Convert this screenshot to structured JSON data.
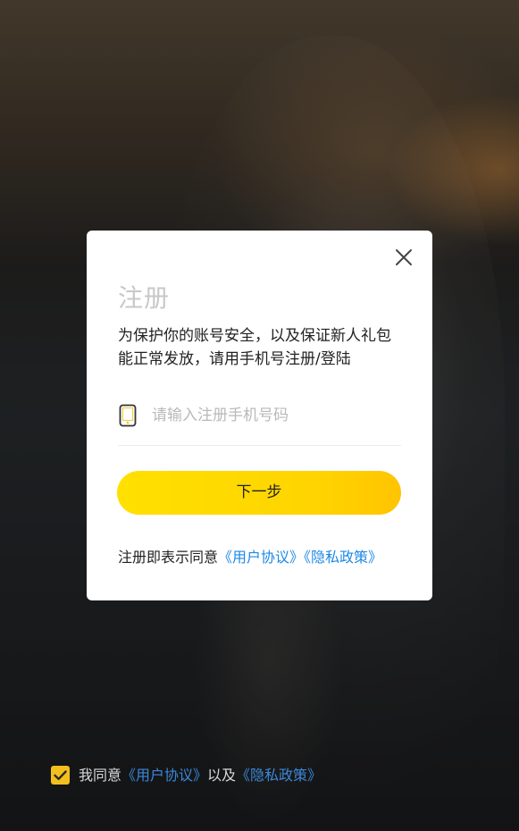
{
  "dialog": {
    "title": "注册",
    "description": "为保护你的账号安全，以及保证新人礼包能正常发放，请用手机号注册/登陆",
    "phone_placeholder": "请输入注册手机号码",
    "next_label": "下一步",
    "agreement_prefix": "注册即表示同意",
    "user_agreement_link": "《用户协议》",
    "privacy_link": "《隐私政策》"
  },
  "bottom_consent": {
    "prefix": "我同意",
    "user_agreement_link": "《用户协议》",
    "connector": "以及",
    "privacy_link": "《隐私政策》",
    "checked": true
  },
  "colors": {
    "accent": "#FFD600",
    "link": "#1E88E5",
    "checkbox": "#F3BF1D"
  },
  "icons": {
    "close": "close-icon",
    "phone": "phone-icon",
    "check": "check-icon"
  }
}
